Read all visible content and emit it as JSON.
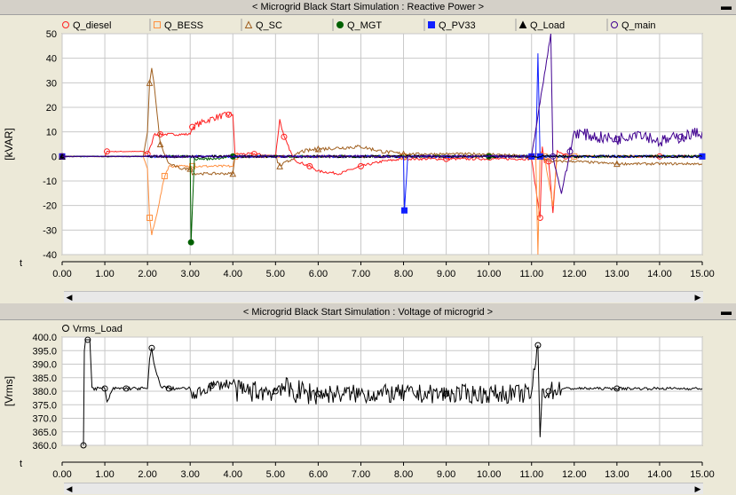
{
  "chart_data": [
    {
      "type": "line",
      "title": "< Microgrid Black Start Simulation : Reactive Power >",
      "xlabel": "t",
      "ylabel": "[kVAR]",
      "xlim": [
        0,
        15
      ],
      "ylim": [
        -40,
        50
      ],
      "xticks": [
        "0.00",
        "1.00",
        "2.00",
        "3.00",
        "4.00",
        "5.00",
        "6.00",
        "7.00",
        "8.00",
        "9.00",
        "10.00",
        "11.00",
        "12.00",
        "13.00",
        "14.00",
        "15.00"
      ],
      "yticks": [
        "50",
        "40",
        "30",
        "20",
        "10",
        "0",
        "-10",
        "-20",
        "-30",
        "-40"
      ],
      "grid": true,
      "legend_position": "top",
      "series": [
        {
          "name": "Q_diesel",
          "color": "#ff2020",
          "marker": "circle-open",
          "x": [
            0,
            0.9,
            1.0,
            1.05,
            1.5,
            1.9,
            2.0,
            2.1,
            2.15,
            2.3,
            2.5,
            3.0,
            3.05,
            3.3,
            3.6,
            3.9,
            4.0,
            4.05,
            4.5,
            5.0,
            5.1,
            5.2,
            5.4,
            5.5,
            5.8,
            6.0,
            6.5,
            7.0,
            7.5,
            8.0,
            9.0,
            10.0,
            11.0,
            11.2,
            11.25,
            11.3,
            11.4,
            11.5,
            11.6,
            11.8,
            12.0,
            13.0,
            14.0,
            15.0
          ],
          "y": [
            0,
            0,
            0,
            2,
            2,
            2,
            1,
            5,
            9,
            9,
            9,
            9,
            12,
            14,
            16,
            17,
            17,
            1,
            1,
            0,
            15,
            8,
            0,
            -2,
            -4,
            -6,
            -7,
            -4,
            -2,
            -1,
            -1,
            -1,
            -1,
            -25,
            4,
            -2,
            -2,
            -23,
            2,
            0,
            0,
            0,
            0,
            0
          ]
        },
        {
          "name": "Q_BESS",
          "color": "#ff9040",
          "marker": "square-open",
          "x": [
            0,
            1.9,
            2.0,
            2.05,
            2.1,
            2.2,
            2.4,
            2.5,
            3.0,
            3.05,
            3.5,
            4.0,
            4.05,
            5.0,
            6.0,
            8.0,
            10.0,
            11.0,
            11.1,
            11.15,
            11.2,
            11.3,
            11.5,
            11.6,
            12.0,
            13.0,
            14.0,
            15.0
          ],
          "y": [
            0,
            0,
            -5,
            -25,
            -32,
            -25,
            -8,
            -4,
            -4,
            -4,
            -4,
            -4,
            0,
            0,
            0,
            0,
            0,
            0,
            0,
            -40,
            2,
            0,
            -20,
            0,
            0,
            0,
            0,
            0
          ]
        },
        {
          "name": "Q_SC",
          "color": "#a06020",
          "marker": "triangle-open",
          "x": [
            0,
            1.9,
            2.0,
            2.05,
            2.1,
            2.15,
            2.3,
            2.5,
            2.8,
            3.0,
            3.05,
            3.5,
            4.0,
            4.05,
            5.0,
            5.1,
            5.3,
            5.6,
            6.0,
            7.0,
            7.5,
            8.0,
            9.0,
            10.0,
            11.0,
            11.5,
            12.0,
            13.0,
            14.0,
            15.0
          ],
          "y": [
            0,
            0,
            10,
            30,
            36,
            30,
            5,
            -3,
            -5,
            -5,
            -7,
            -7,
            -7,
            0,
            0,
            -4,
            -2,
            2,
            3,
            4,
            2,
            1,
            1,
            1,
            0,
            -2,
            -2,
            -3,
            -3,
            -3
          ]
        },
        {
          "name": "Q_MGT",
          "color": "#006000",
          "marker": "circle-filled",
          "x": [
            0,
            2.95,
            3.0,
            3.02,
            3.1,
            3.5,
            4.0,
            5.0,
            8.0,
            10.0,
            15.0
          ],
          "y": [
            0,
            0,
            0,
            -35,
            -1,
            -1,
            0,
            0,
            0,
            0,
            0
          ]
        },
        {
          "name": "Q_PV33",
          "color": "#1020ff",
          "marker": "square-filled",
          "x": [
            0,
            7.9,
            8.0,
            8.02,
            8.1,
            9.0,
            11.0,
            11.1,
            11.15,
            11.2,
            11.3,
            12.0,
            15.0
          ],
          "y": [
            0,
            0,
            0,
            -22,
            0,
            0,
            0,
            0,
            42,
            0,
            0,
            0,
            0
          ]
        },
        {
          "name": "Q_Load",
          "color": "#000000",
          "marker": "triangle-filled",
          "x": [
            0,
            15
          ],
          "y": [
            0,
            0
          ]
        },
        {
          "name": "Q_main",
          "color": "#400090",
          "marker": "circle-open",
          "x": [
            0,
            11.0,
            11.45,
            11.5,
            11.55,
            11.7,
            11.9,
            12.0,
            12.5,
            13.0,
            13.5,
            14.0,
            14.5,
            15.0
          ],
          "y": [
            0,
            0,
            50,
            0,
            -4,
            -15,
            2,
            10,
            8,
            7,
            10,
            6,
            8,
            10
          ]
        }
      ]
    },
    {
      "type": "line",
      "title": "< Microgrid Black Start Simulation : Voltage of microgrid >",
      "xlabel": "t",
      "ylabel": "[Vrms]",
      "xlim": [
        0,
        15
      ],
      "ylim": [
        360,
        400
      ],
      "xticks": [
        "0.00",
        "1.00",
        "2.00",
        "3.00",
        "4.00",
        "5.00",
        "6.00",
        "7.00",
        "8.00",
        "9.00",
        "10.00",
        "11.00",
        "12.00",
        "13.00",
        "14.00",
        "15.00"
      ],
      "yticks": [
        "400.0",
        "395.0",
        "390.0",
        "385.0",
        "380.0",
        "375.0",
        "370.0",
        "365.0",
        "360.0"
      ],
      "grid": true,
      "legend_position": "top-left",
      "series": [
        {
          "name": "Vrms_Load",
          "color": "#000000",
          "marker": "circle-open",
          "x": [
            0.5,
            0.52,
            0.55,
            0.6,
            0.65,
            0.7,
            1.0,
            1.05,
            1.2,
            1.5,
            2.0,
            2.05,
            2.1,
            2.15,
            2.3,
            2.5,
            3.0,
            3.05,
            3.5,
            4.0,
            4.1,
            5.0,
            5.1,
            5.3,
            6.0,
            7.0,
            8.0,
            9.0,
            10.0,
            11.0,
            11.15,
            11.2,
            11.25,
            11.4,
            11.7,
            12.0,
            13.0,
            14.0,
            15.0
          ],
          "y": [
            360,
            395,
            399,
            399,
            399,
            381,
            381,
            376,
            381,
            381,
            381,
            392,
            396,
            390,
            382,
            381,
            381,
            378,
            382,
            383,
            380,
            380,
            383,
            380,
            379,
            379,
            379,
            379,
            379,
            379,
            397,
            363,
            380,
            380,
            381,
            381,
            381,
            381,
            381
          ]
        }
      ]
    }
  ]
}
